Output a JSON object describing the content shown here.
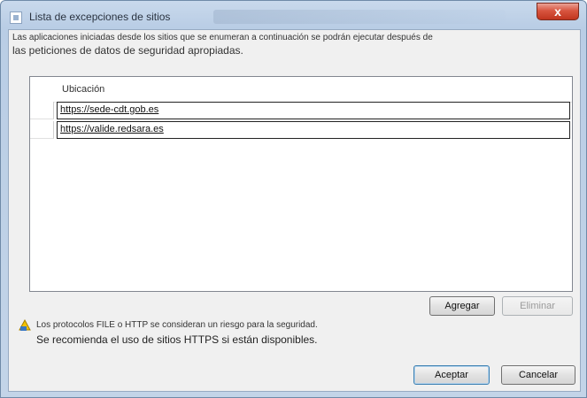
{
  "window": {
    "title": "Lista de excepciones de sitios",
    "close_label": "x"
  },
  "description": {
    "line1": "Las aplicaciones iniciadas desde los sitios que se enumeran a continuación se podrán ejecutar después de",
    "line2": "las peticiones de datos de seguridad apropiadas."
  },
  "table": {
    "column_header": "Ubicación",
    "rows": [
      {
        "location": "https://sede-cdt.gob.es"
      },
      {
        "location": "https://valide.redsara.es"
      }
    ]
  },
  "buttons": {
    "add": "Agregar",
    "remove": "Eliminar",
    "accept": "Aceptar",
    "cancel": "Cancelar"
  },
  "warning": {
    "icon": "warning-shield-icon",
    "line1": "Los protocolos FILE o HTTP se consideran un riesgo para la seguridad.",
    "line2": "Se recomienda el uso de sitios HTTPS si están disponibles."
  }
}
